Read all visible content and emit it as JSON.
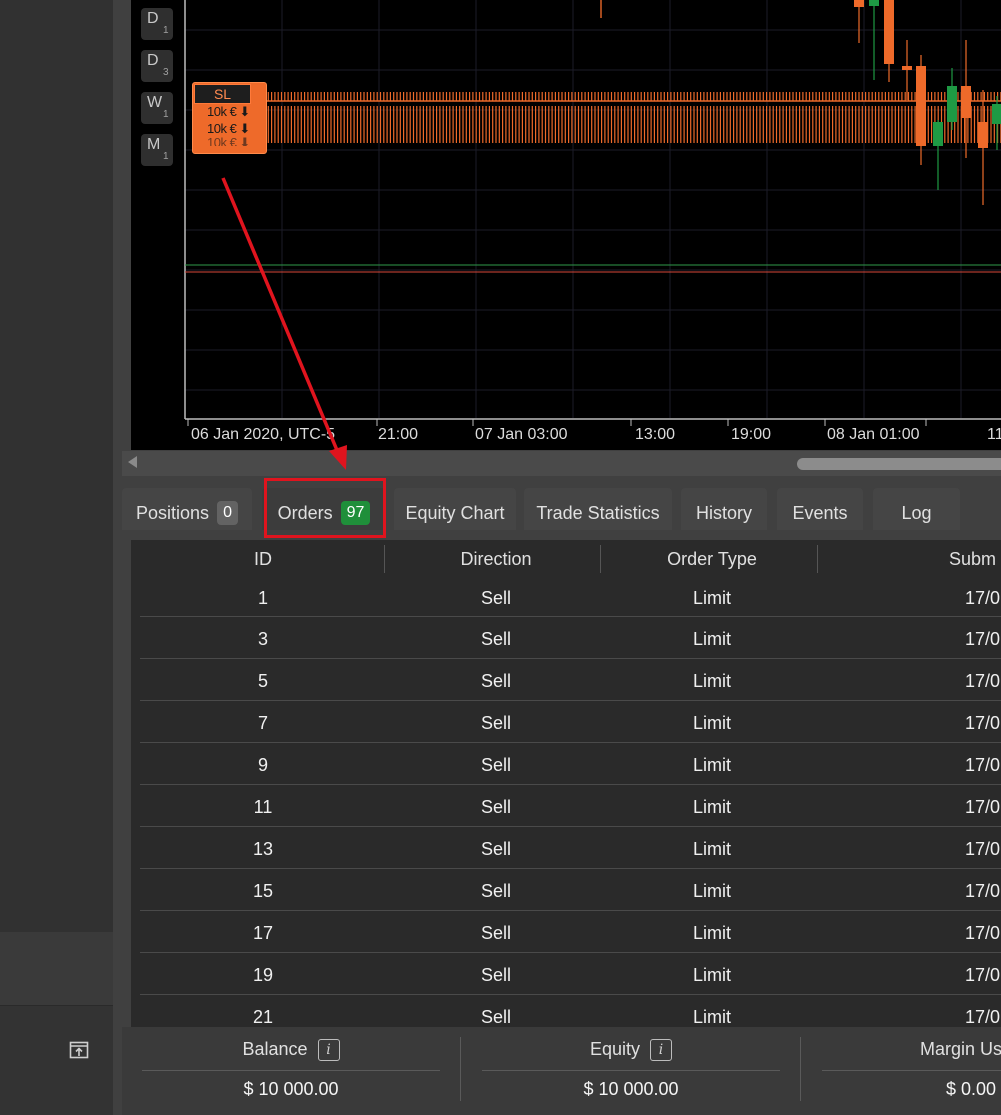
{
  "chart": {
    "timeframes": [
      {
        "letter": "D",
        "num": "1"
      },
      {
        "letter": "D",
        "num": "3"
      },
      {
        "letter": "W",
        "num": "1"
      },
      {
        "letter": "M",
        "num": "1"
      }
    ],
    "sl_label": "SL",
    "order_labels": [
      "10k € ⬇",
      "10k € ⬇",
      "10k € ⬇"
    ],
    "time_labels": [
      "06 Jan 2020, UTC-5",
      "21:00",
      "07 Jan 03:00",
      "13:00",
      "19:00",
      "08 Jan 01:00",
      "11"
    ],
    "colors": {
      "bear": "#ee6a2a",
      "bull": "#1e9a44",
      "background": "#000000"
    }
  },
  "tabs": [
    {
      "label": "Positions",
      "badge": "0"
    },
    {
      "label": "Orders",
      "badge": "97"
    },
    {
      "label": "Equity Chart"
    },
    {
      "label": "Trade Statistics"
    },
    {
      "label": "History"
    },
    {
      "label": "Events"
    },
    {
      "label": "Log"
    }
  ],
  "table": {
    "headers": [
      "ID",
      "Direction",
      "Order Type",
      "Subm"
    ],
    "rows": [
      {
        "id": "1",
        "direction": "Sell",
        "type": "Limit",
        "submitted": "17/0"
      },
      {
        "id": "3",
        "direction": "Sell",
        "type": "Limit",
        "submitted": "17/0"
      },
      {
        "id": "5",
        "direction": "Sell",
        "type": "Limit",
        "submitted": "17/0"
      },
      {
        "id": "7",
        "direction": "Sell",
        "type": "Limit",
        "submitted": "17/0"
      },
      {
        "id": "9",
        "direction": "Sell",
        "type": "Limit",
        "submitted": "17/0"
      },
      {
        "id": "11",
        "direction": "Sell",
        "type": "Limit",
        "submitted": "17/0"
      },
      {
        "id": "13",
        "direction": "Sell",
        "type": "Limit",
        "submitted": "17/0"
      },
      {
        "id": "15",
        "direction": "Sell",
        "type": "Limit",
        "submitted": "17/0"
      },
      {
        "id": "17",
        "direction": "Sell",
        "type": "Limit",
        "submitted": "17/0"
      },
      {
        "id": "19",
        "direction": "Sell",
        "type": "Limit",
        "submitted": "17/0"
      },
      {
        "id": "21",
        "direction": "Sell",
        "type": "Limit",
        "submitted": "17/0"
      }
    ]
  },
  "footer": [
    {
      "label": "Balance",
      "value": "$ 10 000.00"
    },
    {
      "label": "Equity",
      "value": "$ 10 000.00"
    },
    {
      "label": "Margin Used",
      "value": "$ 0.00"
    }
  ],
  "info_glyph": "i",
  "annotation": {
    "color": "#e0141e"
  }
}
